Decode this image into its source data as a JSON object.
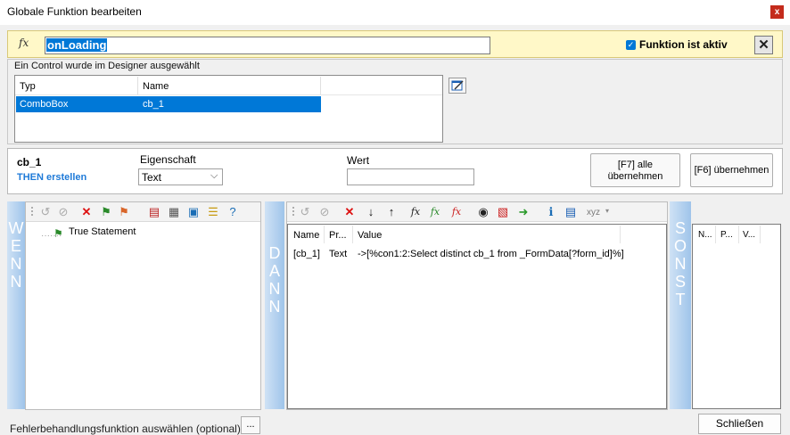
{
  "window": {
    "title": "Globale Funktion bearbeiten",
    "close_glyph": "x"
  },
  "function_bar": {
    "fx_icon": "fx",
    "name": "onLoading",
    "active_checked": true,
    "active_label": "Funktion ist aktiv",
    "close_glyph": "✕"
  },
  "control_panel": {
    "hint": "Ein Control wurde im Designer ausgewählt",
    "columns": [
      "Typ",
      "Name"
    ],
    "rows": [
      {
        "typ": "ComboBox",
        "name": "cb_1",
        "selected": true
      }
    ]
  },
  "property_panel": {
    "control_name": "cb_1",
    "then_label": "THEN erstellen",
    "eigenschaft_label": "Eigenschaft",
    "eigenschaft_value": "Text",
    "wert_label": "Wert",
    "wert_value": "",
    "btn_all_line1": "[F7] alle",
    "btn_all_line2": "übernehmen",
    "btn_apply": "[F6] übernehmen"
  },
  "wenn": {
    "side_letters": [
      "W",
      "E",
      "N",
      "N"
    ],
    "tree": [
      {
        "label": "True Statement",
        "icon": "green-flag-icon"
      }
    ]
  },
  "dann": {
    "side_letters": [
      "D",
      "A",
      "N",
      "N"
    ],
    "xyz_label": "xyz",
    "columns": [
      "Name",
      "Pr...",
      "Value"
    ],
    "rows": [
      {
        "name": "[cb_1]",
        "pr": "Text",
        "value": "->[%con1:2:Select distinct cb_1 from _FormData[?form_id]%]"
      }
    ]
  },
  "sonst": {
    "side_letters": [
      "S",
      "O",
      "N",
      "S",
      "T"
    ],
    "columns": [
      "N...",
      "P...",
      "V..."
    ]
  },
  "footer": {
    "error_label": "Fehlerbehandlungsfunktion auswählen (optional)",
    "browse_label": "...",
    "close_label": "Schließen"
  },
  "colors": {
    "accent": "#0078d7",
    "then_blue": "#1e7ad8",
    "fn_bar_bg": "#fff8c8",
    "side_blue": "#9fc4ea"
  }
}
